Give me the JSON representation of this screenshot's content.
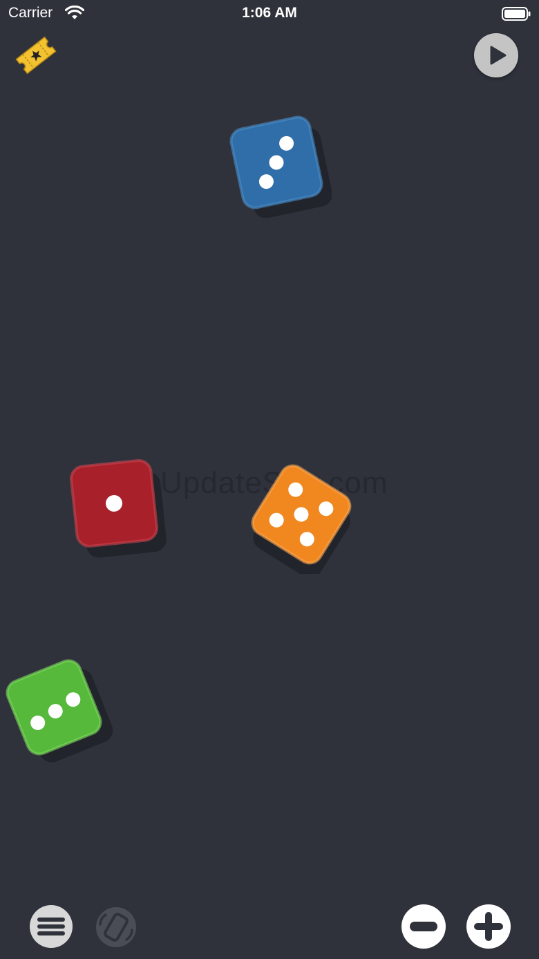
{
  "status_bar": {
    "carrier": "Carrier",
    "time": "1:06 AM"
  },
  "toolbar_top": {
    "ticket_icon": "ticket-star-icon",
    "play_icon": "play-icon"
  },
  "watermark": "UpdateStar.com",
  "dice": [
    {
      "color": "blue",
      "hex": "#2f6ea8",
      "value": 3
    },
    {
      "color": "red",
      "hex": "#a8202a",
      "value": 1
    },
    {
      "color": "orange",
      "hex": "#f0871f",
      "value": 5
    },
    {
      "color": "green",
      "hex": "#56b93b",
      "value": 3
    }
  ],
  "toolbar_bottom": {
    "menu_icon": "hamburger-menu-icon",
    "shake_icon": "shake-icon",
    "remove_die_icon": "minus-icon",
    "add_die_icon": "plus-icon"
  },
  "colors": {
    "background": "#2f323b",
    "button_light": "#d8d8d8",
    "button_white": "#ffffff"
  }
}
